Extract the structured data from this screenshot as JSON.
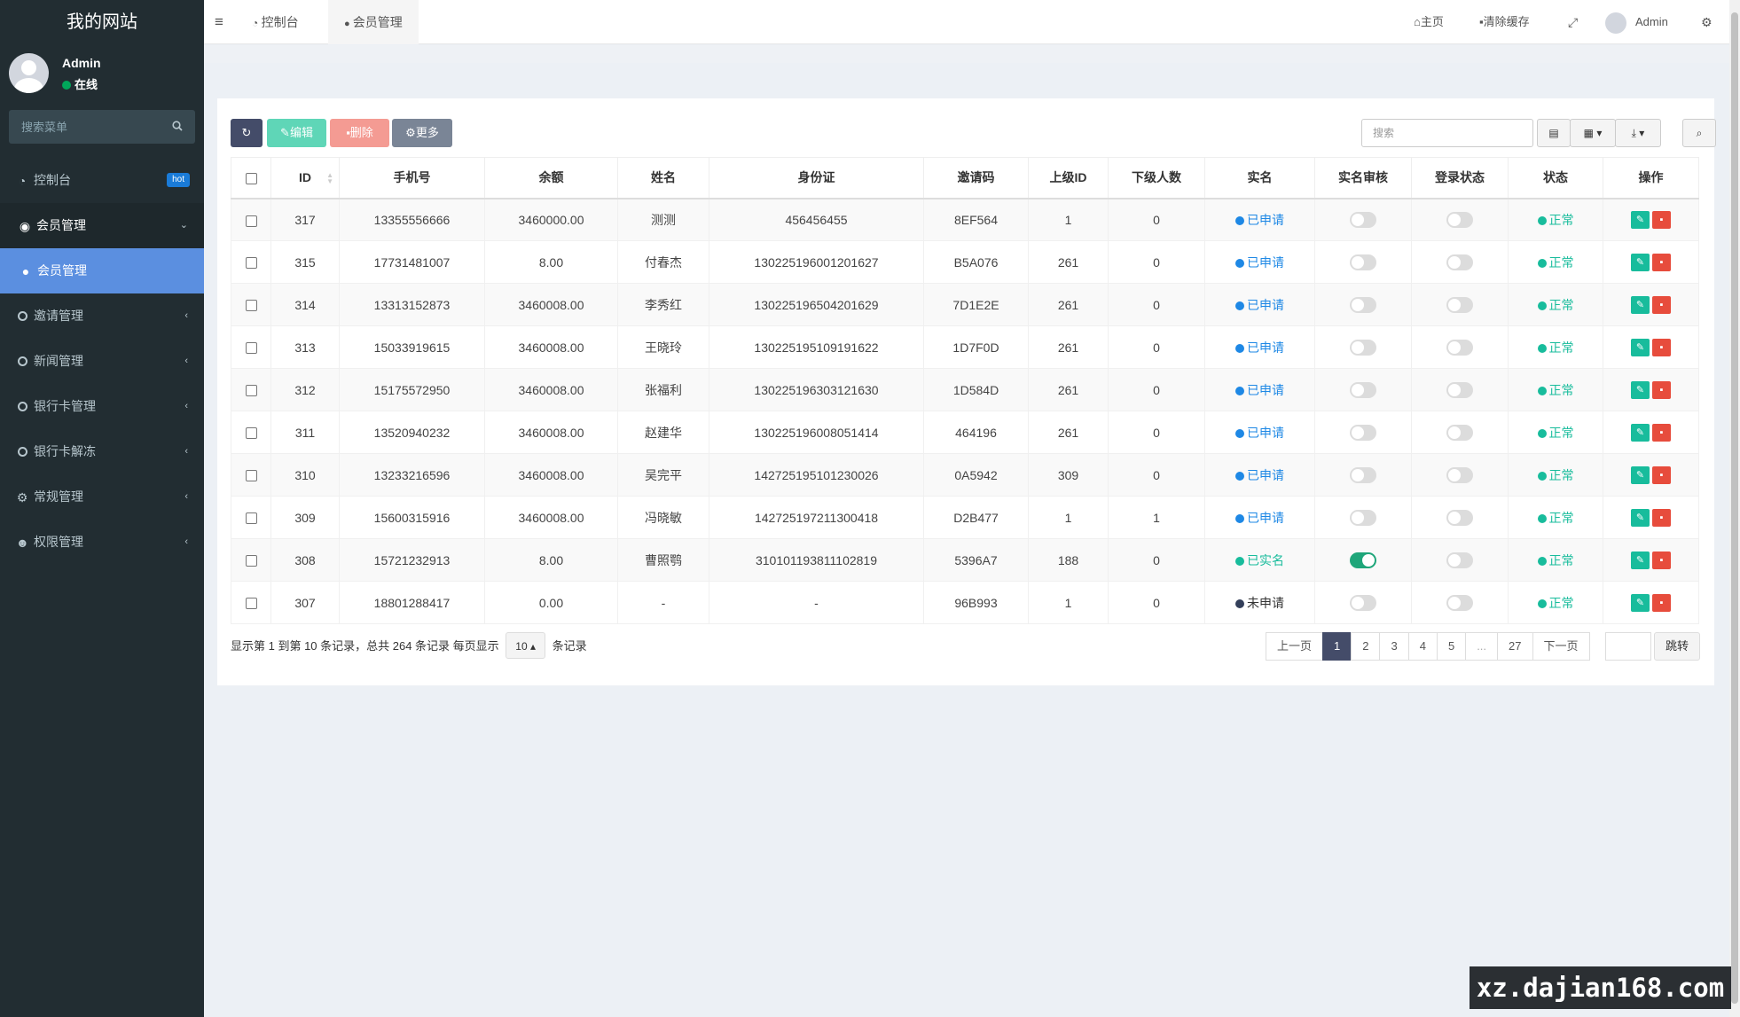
{
  "site_title": "我的网站",
  "user": {
    "name": "Admin",
    "status": "在线"
  },
  "sidebar_search_placeholder": "搜索菜单",
  "menu": [
    {
      "label": "控制台",
      "badge": "hot",
      "icon": "dashboard-icon"
    },
    {
      "label": "会员管理",
      "icon": "user-circle-icon",
      "expanded": true
    },
    {
      "label": "会员管理",
      "icon": "user-icon",
      "submenu": true
    },
    {
      "label": "邀请管理",
      "icon": "circle-icon"
    },
    {
      "label": "新闻管理",
      "icon": "circle-icon"
    },
    {
      "label": "银行卡管理",
      "icon": "circle-icon"
    },
    {
      "label": "银行卡解冻",
      "icon": "circle-icon"
    },
    {
      "label": "常规管理",
      "icon": "cogs-icon"
    },
    {
      "label": "权限管理",
      "icon": "users-icon"
    }
  ],
  "topbar": {
    "tabs": [
      {
        "label": "控制台"
      },
      {
        "label": "会员管理"
      }
    ],
    "home": "主页",
    "clear_cache": "清除缓存",
    "admin": "Admin"
  },
  "toolbar": {
    "edit": "编辑",
    "delete": "删除",
    "more": "更多",
    "search_placeholder": "搜索"
  },
  "columns": [
    "ID",
    "手机号",
    "余额",
    "姓名",
    "身份证",
    "邀请码",
    "上级ID",
    "下级人数",
    "实名",
    "实名审核",
    "登录状态",
    "状态",
    "操作"
  ],
  "rows": [
    {
      "id": "317",
      "phone": "13355556666",
      "balance": "3460000.00",
      "name": "测测",
      "idcard": "456456455",
      "code": "8EF564",
      "parent": "1",
      "subs": "0",
      "realname": "已申请",
      "rn_color": "#1e88e5",
      "audit": false,
      "status": "正常"
    },
    {
      "id": "315",
      "phone": "17731481007",
      "balance": "8.00",
      "name": "付春杰",
      "idcard": "130225196001201627",
      "code": "B5A076",
      "parent": "261",
      "subs": "0",
      "realname": "已申请",
      "rn_color": "#1e88e5",
      "audit": false,
      "status": "正常"
    },
    {
      "id": "314",
      "phone": "13313152873",
      "balance": "3460008.00",
      "name": "李秀红",
      "idcard": "130225196504201629",
      "code": "7D1E2E",
      "parent": "261",
      "subs": "0",
      "realname": "已申请",
      "rn_color": "#1e88e5",
      "audit": false,
      "status": "正常"
    },
    {
      "id": "313",
      "phone": "15033919615",
      "balance": "3460008.00",
      "name": "王晓玲",
      "idcard": "130225195109191622",
      "code": "1D7F0D",
      "parent": "261",
      "subs": "0",
      "realname": "已申请",
      "rn_color": "#1e88e5",
      "audit": false,
      "status": "正常"
    },
    {
      "id": "312",
      "phone": "15175572950",
      "balance": "3460008.00",
      "name": "张福利",
      "idcard": "130225196303121630",
      "code": "1D584D",
      "parent": "261",
      "subs": "0",
      "realname": "已申请",
      "rn_color": "#1e88e5",
      "audit": false,
      "status": "正常"
    },
    {
      "id": "311",
      "phone": "13520940232",
      "balance": "3460008.00",
      "name": "赵建华",
      "idcard": "130225196008051414",
      "code": "464196",
      "parent": "261",
      "subs": "0",
      "realname": "已申请",
      "rn_color": "#1e88e5",
      "audit": false,
      "status": "正常"
    },
    {
      "id": "310",
      "phone": "13233216596",
      "balance": "3460008.00",
      "name": "吴完平",
      "idcard": "142725195101230026",
      "code": "0A5942",
      "parent": "309",
      "subs": "0",
      "realname": "已申请",
      "rn_color": "#1e88e5",
      "audit": false,
      "status": "正常"
    },
    {
      "id": "309",
      "phone": "15600315916",
      "balance": "3460008.00",
      "name": "冯晓敏",
      "idcard": "142725197211300418",
      "code": "D2B477",
      "parent": "1",
      "subs": "1",
      "realname": "已申请",
      "rn_color": "#1e88e5",
      "audit": false,
      "status": "正常"
    },
    {
      "id": "308",
      "phone": "15721232913",
      "balance": "8.00",
      "name": "曹照鹗",
      "idcard": "310101193811102819",
      "code": "5396A7",
      "parent": "188",
      "subs": "0",
      "realname": "已实名",
      "rn_color": "#18bc9c",
      "audit": true,
      "status": "正常"
    },
    {
      "id": "307",
      "phone": "18801288417",
      "balance": "0.00",
      "name": "-",
      "idcard": "-",
      "code": "96B993",
      "parent": "1",
      "subs": "0",
      "realname": "未申请",
      "rn_color": "#333f5a",
      "audit": false,
      "status": "正常"
    }
  ],
  "footer": {
    "summary": "显示第 1 到第 10 条记录，总共 264 条记录 每页显示",
    "page_size": "10",
    "suffix": "条记录"
  },
  "pagination": {
    "prev": "上一页",
    "pages": [
      "1",
      "2",
      "3",
      "4",
      "5",
      "...",
      "27"
    ],
    "current": "1",
    "next": "下一页",
    "jump": "跳转"
  },
  "watermark": "xz.dajian168.com",
  "colors": {
    "sidebar": "#222d32",
    "accent": "#444c69",
    "status_green": "#18bc9c"
  }
}
